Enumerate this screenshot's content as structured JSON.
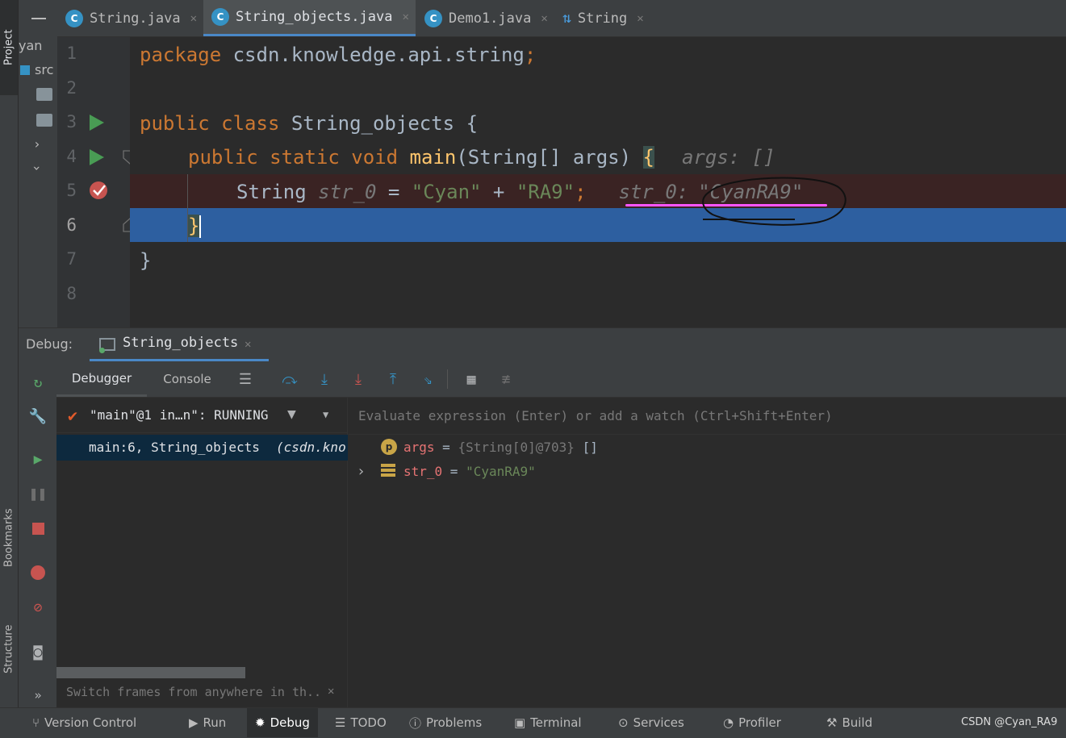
{
  "sidebar": {
    "project_label": "Project",
    "bookmarks_label": "Bookmarks",
    "structure_label": "Structure",
    "project_partial": "yan",
    "src_partial": "src"
  },
  "tabs": [
    {
      "label": "String.java",
      "icon": "class-icon"
    },
    {
      "label": "String_objects.java",
      "icon": "class-icon",
      "active": true
    },
    {
      "label": "Demo1.java",
      "icon": "class-icon"
    },
    {
      "label": "String",
      "icon": "structure-icon"
    }
  ],
  "editor": {
    "line_numbers": [
      "1",
      "2",
      "3",
      "4",
      "5",
      "6",
      "7",
      "8"
    ],
    "line1": {
      "kw": "package",
      "pkg": " csdn.knowledge.api.string",
      "semi": ";"
    },
    "line3": {
      "kw": "public class",
      "name": " String_objects ",
      "brace": "{"
    },
    "line4": {
      "kw": "public static void",
      "fn": " main",
      "params": "(String[] args) ",
      "brace": "{",
      "hint": "args: []"
    },
    "line5": {
      "type": "String ",
      "var": "str_0",
      "op": " = ",
      "s1": "\"Cyan\"",
      "plus": " + ",
      "s2": "\"RA9\"",
      "semi": ";",
      "hint_name": "str_0:",
      "hint_value": "\"CyanRA9\""
    },
    "line6": {
      "brace": "}"
    },
    "line7": {
      "brace": "}"
    }
  },
  "debug": {
    "label": "Debug:",
    "session_tab": "String_objects",
    "tabs": [
      "Debugger",
      "Console"
    ],
    "thread": "\"main\"@1 in…n\": RUNNING",
    "frame_text": "main:6, String_objects",
    "frame_pkg": "(csdn.kno",
    "frames_hint": "Switch frames from anywhere in th..",
    "eval_placeholder": "Evaluate expression (Enter) or add a watch (Ctrl+Shift+Enter)",
    "variables": [
      {
        "name": "args",
        "eq": " = ",
        "value": "{String[0]@703}",
        "extra": " []",
        "icon": "p"
      },
      {
        "name": "str_0",
        "eq": " = ",
        "value": "\"CyanRA9\"",
        "extra": "",
        "icon": "field"
      }
    ]
  },
  "status_bar": {
    "items": [
      "Version Control",
      "Run",
      "Debug",
      "TODO",
      "Problems",
      "Terminal",
      "Services",
      "Profiler",
      "Build"
    ],
    "active": "Debug",
    "watermark": "CSDN @Cyan_RA9"
  },
  "colors": {
    "accent": "#4a88c7",
    "selection": "#2d5fa0",
    "breakpoint_line": "#3a2323",
    "highlight_underline": "#ff55ff"
  }
}
